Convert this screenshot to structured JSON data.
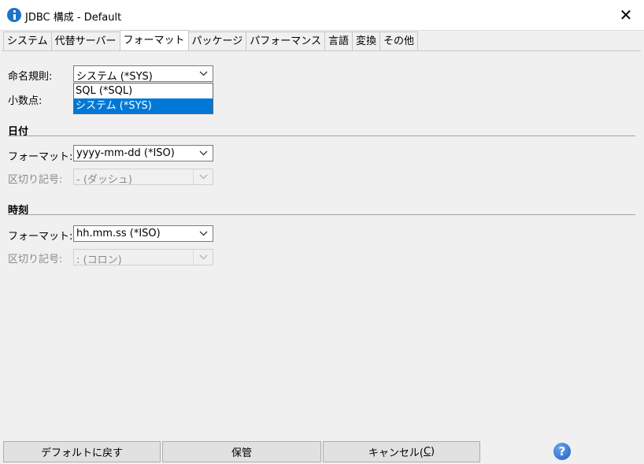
{
  "window": {
    "title": "JDBC 構成 - Default",
    "close_glyph": "✕"
  },
  "tabs": [
    {
      "label": "システム"
    },
    {
      "label": "代替サーバー"
    },
    {
      "label": "フォーマット",
      "active": true
    },
    {
      "label": "パッケージ"
    },
    {
      "label": "パフォーマンス"
    },
    {
      "label": "言語"
    },
    {
      "label": "変換"
    },
    {
      "label": "その他"
    }
  ],
  "format": {
    "naming_label": "命名規則:",
    "naming_value": "システム (*SYS)",
    "naming_options": [
      "SQL (*SQL)",
      "システム (*SYS)"
    ],
    "decimal_label": "小数点:"
  },
  "date": {
    "section_title": "日付",
    "format_label": "フォーマット:",
    "format_value": "yyyy-mm-dd (*ISO)",
    "separator_label": "区切り記号:",
    "separator_value": "- (ダッシュ)"
  },
  "time": {
    "section_title": "時刻",
    "format_label": "フォーマット:",
    "format_value": "hh.mm.ss (*ISO)",
    "separator_label": "区切り記号:",
    "separator_value": ": (コロン)"
  },
  "buttons": {
    "default": "デフォルトに戻す",
    "save": "保管",
    "cancel_prefix": "キャンセル(",
    "cancel_key": "C",
    "cancel_suffix": ")",
    "help_glyph": "?"
  },
  "colors": {
    "selection": "#0078d7",
    "background": "#f0f0f0",
    "help_icon": "#1e5fbf"
  }
}
